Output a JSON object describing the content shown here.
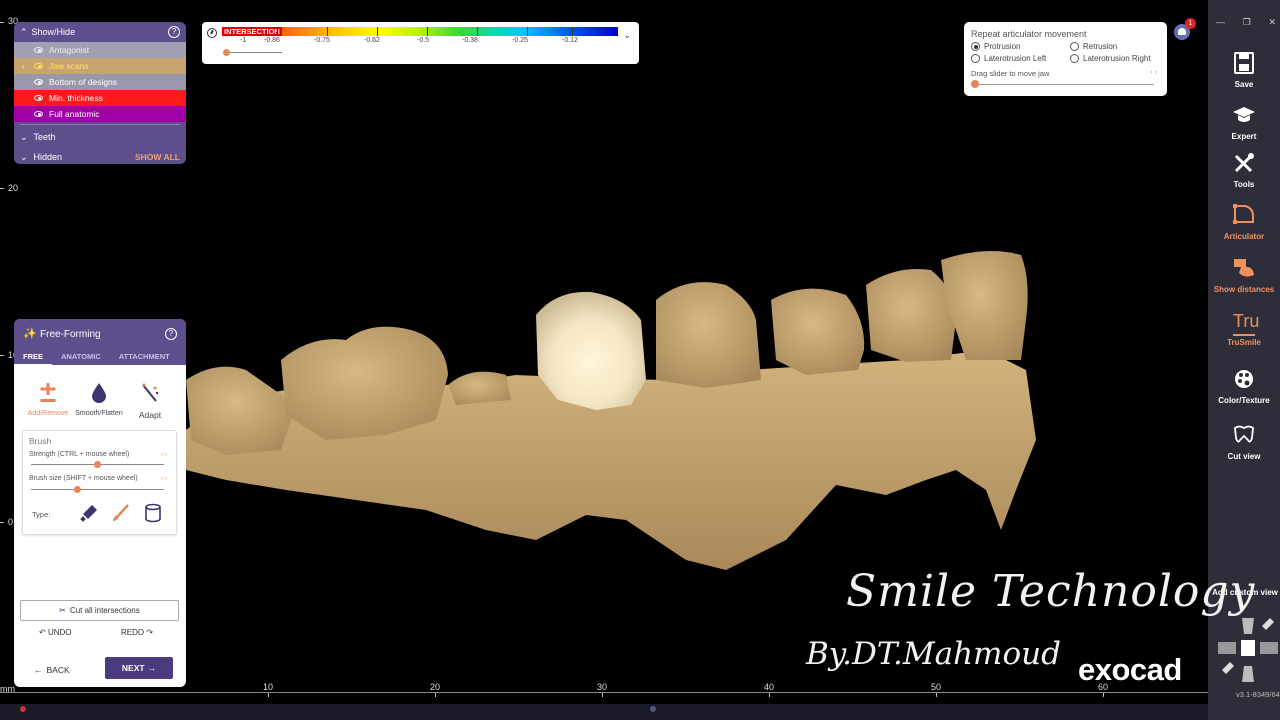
{
  "ruler_left": {
    "labels": [
      "30",
      "20",
      "10",
      "0"
    ]
  },
  "ruler_bottom": {
    "unit": "mm",
    "labels": [
      "10",
      "20",
      "30",
      "40",
      "50",
      "60"
    ]
  },
  "show_hide": {
    "title": "Show/Hide",
    "layers": [
      "Antagonist",
      "Jaw scans",
      "Bottom of designs",
      "Min. thickness",
      "Full anatomic"
    ],
    "groups": {
      "teeth": "Teeth",
      "hidden": "Hidden",
      "show_all": "SHOW ALL"
    }
  },
  "intersection": {
    "title": "INTERSECTION",
    "ticks": [
      "-1",
      "-0.86",
      "-0.75",
      "-0.62",
      "-0.5",
      "-0.38",
      "-0.25",
      "-0.12"
    ]
  },
  "articulator_panel": {
    "title": "Repeat articulator movement",
    "options": [
      "Protrusion",
      "Retrusion",
      "Laterotrusion Left",
      "Laterotrusion Right"
    ],
    "selected": "Protrusion",
    "drag_label": "Drag slider to move jaw"
  },
  "notifications": {
    "count": "1"
  },
  "free_forming": {
    "title": "Free-Forming",
    "tabs": [
      "FREE",
      "ANATOMIC",
      "ATTACHMENT"
    ],
    "tools": {
      "add": "Add/Remove",
      "smooth": "Smooth/Flatten",
      "adapt": "Adapt"
    },
    "brush": {
      "title": "Brush",
      "strength_label": "Strength (CTRL + mouse wheel)",
      "strength_value": 0.5,
      "size_label": "Brush size (SHIFT + mouse wheel)",
      "size_value": 0.35,
      "type_label": "Type:"
    },
    "cut_all": "Cut all intersections",
    "undo": "UNDO",
    "redo": "REDO",
    "back": "BACK",
    "next": "NEXT"
  },
  "toolbar": {
    "save": "Save",
    "expert": "Expert",
    "tools": "Tools",
    "articulator": "Articulator",
    "show_distances": "Show distances",
    "trusmile": "TruSmile",
    "color_texture": "Color/Texture",
    "cut_view": "Cut view",
    "add_custom_view": "Add custom view",
    "version": "v3.1-8349/64"
  },
  "watermark": {
    "line1": "Smile Technology",
    "line2": "By.DT.Mahmoud",
    "brand": "exocad"
  },
  "colors": {
    "accent": "#e8865a",
    "panel": "#5d4e8c",
    "jaw": "#c8a56f"
  }
}
